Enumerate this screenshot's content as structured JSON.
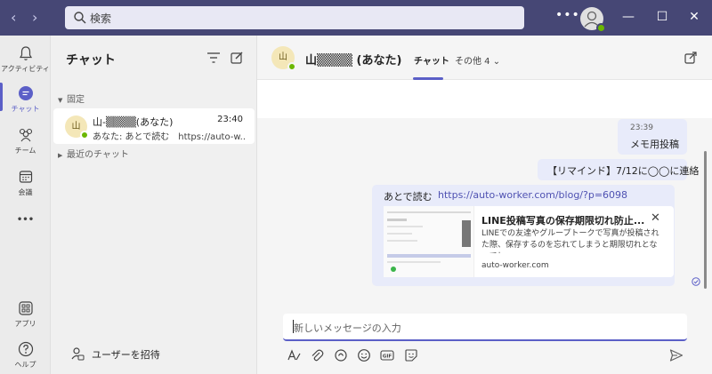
{
  "titlebar": {
    "back": "‹",
    "forward": "›",
    "search_placeholder": "検索",
    "more": "•••",
    "minimize": "—",
    "maximize": "☐",
    "close": "✕"
  },
  "rail": {
    "items": [
      {
        "label": "アクティビティ",
        "icon": "bell-icon"
      },
      {
        "label": "チャット",
        "icon": "chat-icon"
      },
      {
        "label": "チーム",
        "icon": "teams-icon"
      },
      {
        "label": "会議",
        "icon": "calendar-icon"
      },
      {
        "label": "•••",
        "icon": "more-icon"
      },
      {
        "label": "アプリ",
        "icon": "apps-icon"
      },
      {
        "label": "ヘルプ",
        "icon": "help-icon"
      }
    ],
    "active_color": "#5b5fc7"
  },
  "chatlist": {
    "title": "チャット",
    "pinned_label": "固定",
    "recent_label": "最近のチャット",
    "item": {
      "avatar": "山",
      "name": "山-▒▒▒▒(あなた)",
      "time": "23:40",
      "preview": "あなた: あとで読む　https://auto-w..."
    },
    "invite_label": "ユーザーを招待"
  },
  "header": {
    "avatar": "山",
    "name": "山▒▒▒▒ (あなた)",
    "tab_chat": "チャット",
    "tab_other": "その他 4",
    "tab_other_caret": "⌄"
  },
  "messages": {
    "m1_time": "23:39",
    "m1_text": "メモ用投稿",
    "m2_text": "【リマインド】7/12に◯◯に連絡",
    "m3_prefix": "あとで読む",
    "m3_link": "https://auto-worker.com/blog/?p=6098",
    "card": {
      "title": "LINE投稿写真の保存期限切れ防止...",
      "desc": "LINEでの友達やグループトークで写真が投稿された際、保存するのを忘れてしまうと期限切れとなってし...",
      "domain": "auto-worker.com",
      "close": "✕"
    }
  },
  "compose": {
    "placeholder": "新しいメッセージの入力"
  },
  "colors": {
    "titlebar": "#464775",
    "accent": "#5b5fc7",
    "bubble": "#e8ebfa",
    "presence": "#6bb700"
  }
}
